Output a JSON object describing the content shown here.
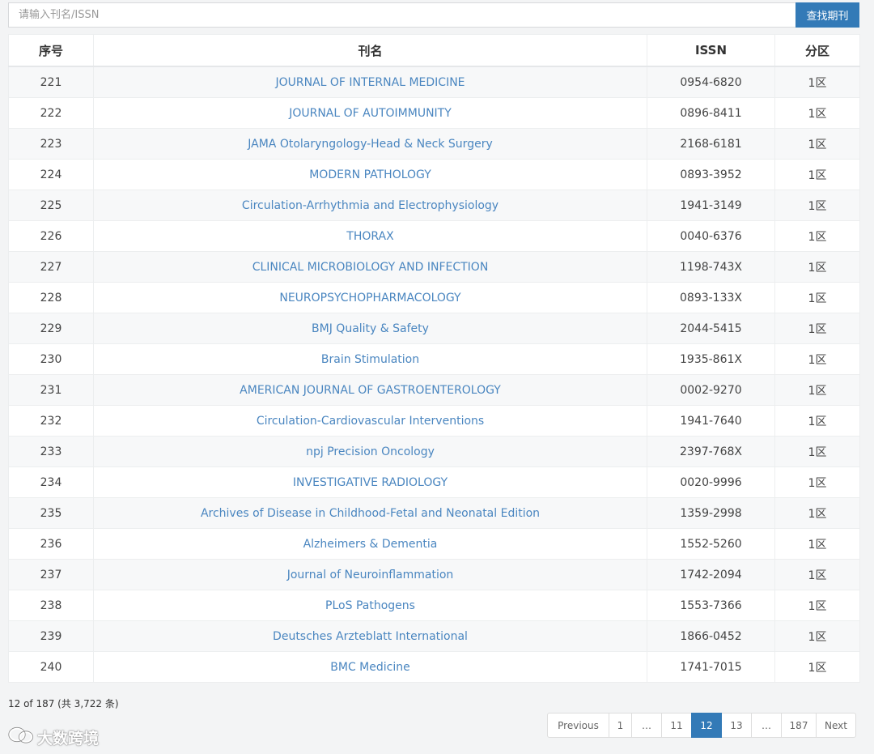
{
  "search": {
    "placeholder": "请输入刊名/ISSN",
    "button_label": "查找期刊"
  },
  "table": {
    "headers": {
      "seq": "序号",
      "name": "刊名",
      "issn": "ISSN",
      "zone": "分区"
    },
    "rows": [
      {
        "seq": "221",
        "name": "JOURNAL OF INTERNAL MEDICINE",
        "issn": "0954-6820",
        "zone": "1区"
      },
      {
        "seq": "222",
        "name": "JOURNAL OF AUTOIMMUNITY",
        "issn": "0896-8411",
        "zone": "1区"
      },
      {
        "seq": "223",
        "name": "JAMA Otolaryngology-Head & Neck Surgery",
        "issn": "2168-6181",
        "zone": "1区"
      },
      {
        "seq": "224",
        "name": "MODERN PATHOLOGY",
        "issn": "0893-3952",
        "zone": "1区"
      },
      {
        "seq": "225",
        "name": "Circulation-Arrhythmia and Electrophysiology",
        "issn": "1941-3149",
        "zone": "1区"
      },
      {
        "seq": "226",
        "name": "THORAX",
        "issn": "0040-6376",
        "zone": "1区"
      },
      {
        "seq": "227",
        "name": "CLINICAL MICROBIOLOGY AND INFECTION",
        "issn": "1198-743X",
        "zone": "1区"
      },
      {
        "seq": "228",
        "name": "NEUROPSYCHOPHARMACOLOGY",
        "issn": "0893-133X",
        "zone": "1区"
      },
      {
        "seq": "229",
        "name": "BMJ Quality & Safety",
        "issn": "2044-5415",
        "zone": "1区"
      },
      {
        "seq": "230",
        "name": "Brain Stimulation",
        "issn": "1935-861X",
        "zone": "1区"
      },
      {
        "seq": "231",
        "name": "AMERICAN JOURNAL OF GASTROENTEROLOGY",
        "issn": "0002-9270",
        "zone": "1区"
      },
      {
        "seq": "232",
        "name": "Circulation-Cardiovascular Interventions",
        "issn": "1941-7640",
        "zone": "1区"
      },
      {
        "seq": "233",
        "name": "npj Precision Oncology",
        "issn": "2397-768X",
        "zone": "1区"
      },
      {
        "seq": "234",
        "name": "INVESTIGATIVE RADIOLOGY",
        "issn": "0020-9996",
        "zone": "1区"
      },
      {
        "seq": "235",
        "name": "Archives of Disease in Childhood-Fetal and Neonatal Edition",
        "issn": "1359-2998",
        "zone": "1区"
      },
      {
        "seq": "236",
        "name": "Alzheimers & Dementia",
        "issn": "1552-5260",
        "zone": "1区"
      },
      {
        "seq": "237",
        "name": "Journal of Neuroinflammation",
        "issn": "1742-2094",
        "zone": "1区"
      },
      {
        "seq": "238",
        "name": "PLoS Pathogens",
        "issn": "1553-7366",
        "zone": "1区"
      },
      {
        "seq": "239",
        "name": "Deutsches Arzteblatt International",
        "issn": "1866-0452",
        "zone": "1区"
      },
      {
        "seq": "240",
        "name": "BMC Medicine",
        "issn": "1741-7015",
        "zone": "1区"
      }
    ]
  },
  "footer": {
    "page_info": "12 of 187 (共 3,722 条)"
  },
  "pagination": {
    "items": [
      {
        "label": "Previous",
        "active": false
      },
      {
        "label": "1",
        "active": false
      },
      {
        "label": "…",
        "active": false
      },
      {
        "label": "11",
        "active": false
      },
      {
        "label": "12",
        "active": true
      },
      {
        "label": "13",
        "active": false
      },
      {
        "label": "…",
        "active": false
      },
      {
        "label": "187",
        "active": false
      },
      {
        "label": "Next",
        "active": false
      }
    ]
  },
  "watermark": {
    "text": "大数跨境",
    "icon": "wechat-logo-icon"
  },
  "colors": {
    "accent": "#337ab7",
    "link": "#4a86c0",
    "row_stripe": "#f7f8f9",
    "background": "#f3f4f5"
  }
}
